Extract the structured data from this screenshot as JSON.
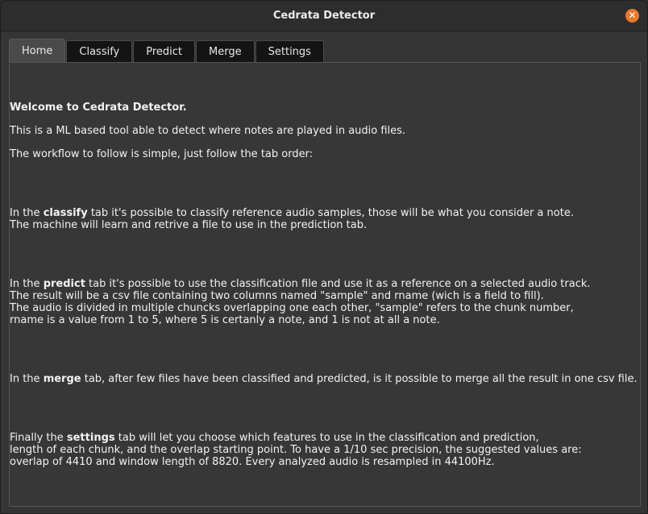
{
  "window": {
    "title": "Cedrata Detector",
    "close_icon": "close-icon"
  },
  "tabs": [
    {
      "label": "Home",
      "active": true
    },
    {
      "label": "Classify",
      "active": false
    },
    {
      "label": "Predict",
      "active": false
    },
    {
      "label": "Merge",
      "active": false
    },
    {
      "label": "Settings",
      "active": false
    }
  ],
  "home": {
    "welcome": "Welcome to Cedrata Detector.",
    "intro": "This is a ML based tool able to detect where notes are played in audio files.",
    "workflow": "The workflow to follow is simple, just follow the tab order:",
    "classify": {
      "pre": "In the ",
      "keyword": "classify",
      "post": " tab it's possible to classify reference audio samples, those will be what you consider a note.",
      "line2": "The machine will learn and retrive a file to use in the prediction tab."
    },
    "predict": {
      "pre": "In the ",
      "keyword": "predict",
      "post": " tab it's possible to use the classification file and use it as a reference on a selected audio track.",
      "line2": "The result will be a csv file containing two columns named \"sample\" and rname (wich is a field to fill).",
      "line3": "The audio is divided in multiple chuncks overlapping one each other, \"sample\" refers to the chunk number,",
      "line4": "rname is a value from 1 to 5, where 5 is certanly a note, and 1 is not at all a note."
    },
    "merge": {
      "pre": "In the ",
      "keyword": "merge",
      "post": " tab, after few files have been classified and predicted, is it possible to merge all the result in one csv file."
    },
    "settings": {
      "pre": "Finally the ",
      "keyword": "settings",
      "post": " tab will let you choose which features to use in the classification and prediction,",
      "line2": "length of each chunk, and the overlap starting point. To have a 1/10 sec precision, the suggested values are:",
      "line3": "overlap of 4410 and window length of 8820. Every analyzed audio is resampled in 44100Hz."
    }
  },
  "colors": {
    "accent_close": "#e9782b",
    "background": "#353535",
    "tab_inactive": "#141414",
    "tab_active": "#4a4a4a"
  }
}
